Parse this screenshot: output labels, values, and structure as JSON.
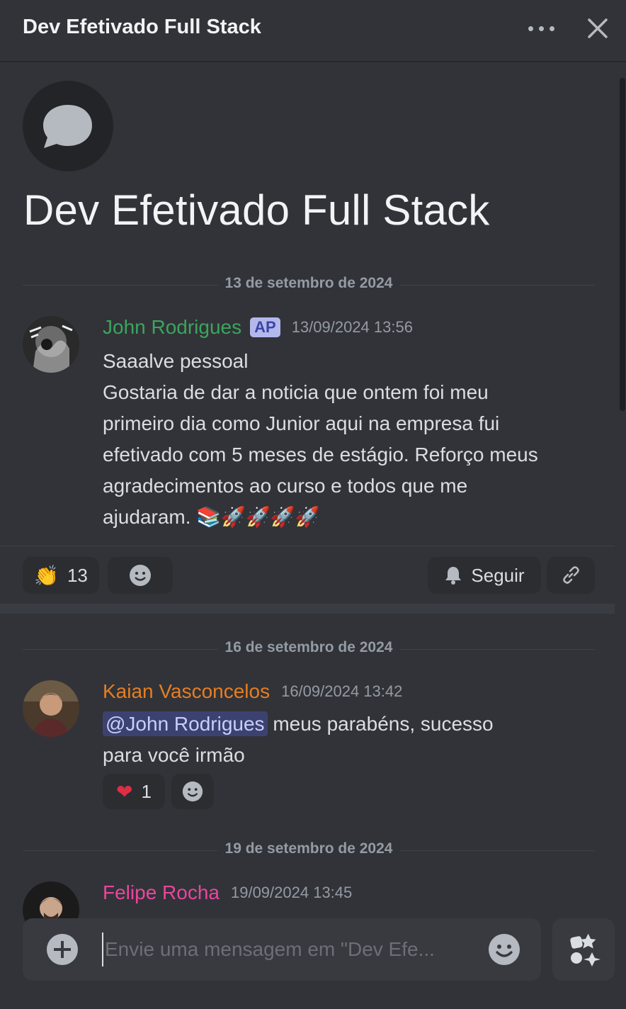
{
  "header": {
    "title": "Dev Efetivado Full Stack"
  },
  "thread": {
    "heading": "Dev Efetivado Full Stack"
  },
  "dates": [
    "13 de setembro de 2024",
    "16 de setembro de 2024",
    "19 de setembro de 2024"
  ],
  "messages": [
    {
      "author": "John Rodrigues",
      "author_color": "#3ba55d",
      "badge": "AP",
      "timestamp": "13/09/2024 13:56",
      "lines": [
        "Saaalve pessoal",
        "Gostaria de dar a noticia que ontem foi meu primeiro dia como Junior aqui na empresa fui efetivado com 5 meses de estágio. Reforço meus agradecimentos ao curso e todos que me ajudaram. 📚🚀🚀🚀🚀"
      ],
      "reactions": [
        {
          "emoji": "👏",
          "count": "13"
        }
      ],
      "follow_label": "Seguir"
    },
    {
      "author": "Kaian Vasconcelos",
      "author_color": "#e67e22",
      "timestamp": "16/09/2024 13:42",
      "mention": "@John Rodrigues",
      "text": " meus parabéns, sucesso para você irmão",
      "reactions": [
        {
          "emoji": "❤",
          "count": "1"
        }
      ]
    },
    {
      "author": "Felipe Rocha",
      "author_color": "#eb459e",
      "timestamp": "19/09/2024 13:45"
    }
  ],
  "composer": {
    "placeholder": "Envie uma mensagem em \"Dev Efe..."
  }
}
